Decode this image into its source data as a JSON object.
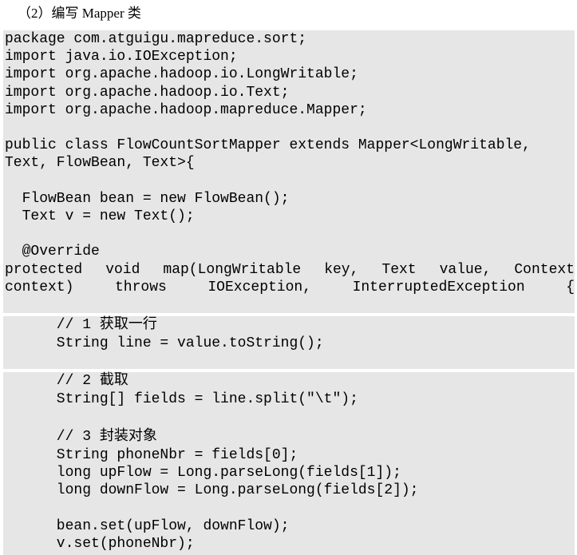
{
  "heading": "（2）编写 Mapper 类",
  "code": {
    "block1": [
      "package com.atguigu.mapreduce.sort;",
      "import java.io.IOException;",
      "import org.apache.hadoop.io.LongWritable;",
      "import org.apache.hadoop.io.Text;",
      "import org.apache.hadoop.mapreduce.Mapper;",
      "public class FlowCountSortMapper extends Mapper<LongWritable,",
      "Text, FlowBean, Text>{",
      "  FlowBean bean = new FlowBean();",
      "  Text v = new Text();",
      "  @Override",
      "  protected void map(LongWritable key, Text value, Context",
      "context) throws IOException, InterruptedException {"
    ],
    "block2": [
      "      // 1 获取一行",
      "      String line = value.toString();"
    ],
    "block3": [
      "      // 2 截取",
      "      String[] fields = line.split(\"\\t\");",
      "      // 3 封装对象",
      "      String phoneNbr = fields[0];",
      "      long upFlow = Long.parseLong(fields[1]);",
      "      long downFlow = Long.parseLong(fields[2]);",
      "      bean.set(upFlow, downFlow);",
      "      v.set(phoneNbr);"
    ]
  }
}
